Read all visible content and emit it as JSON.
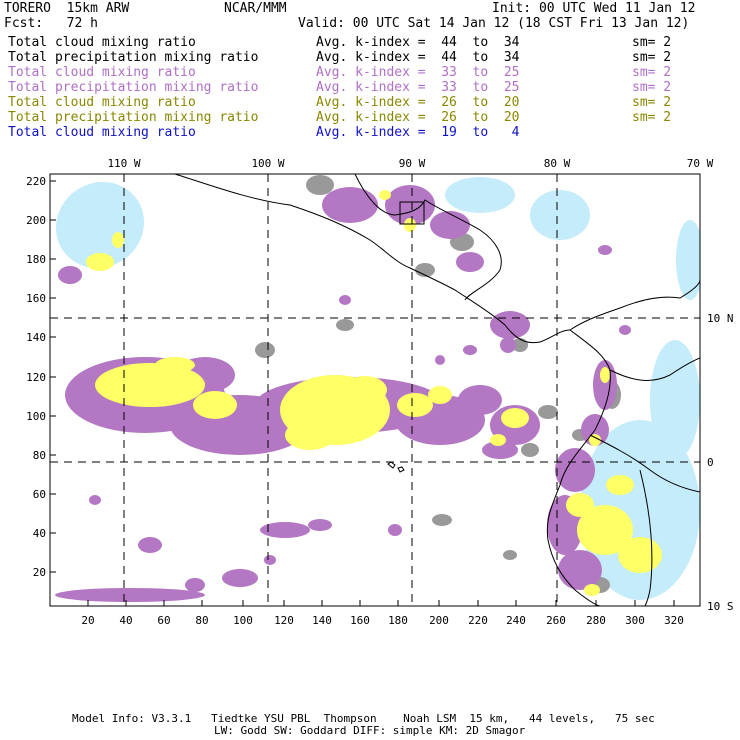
{
  "header": {
    "model": "TORERO  15km ARW",
    "org": "NCAR/MMM",
    "init": "Init: 00 UTC Wed 11 Jan 12",
    "fcst": "Fcst:   72 h",
    "valid": "Valid: 00 UTC Sat 14 Jan 12 (18 CST Fri 13 Jan 12)"
  },
  "legend": [
    {
      "field": "Total cloud mixing ratio",
      "kindex": "Avg. k-index =  44  to  34",
      "sm": "sm= 2",
      "color": "#000000"
    },
    {
      "field": "Total precipitation mixing ratio",
      "kindex": "Avg. k-index =  44  to  34",
      "sm": "sm= 2",
      "color": "#000000"
    },
    {
      "field": "Total cloud mixing ratio",
      "kindex": "Avg. k-index =  33  to  25",
      "sm": "sm= 2",
      "color": "#b070c8"
    },
    {
      "field": "Total precipitation mixing ratio",
      "kindex": "Avg. k-index =  33  to  25",
      "sm": "sm= 2",
      "color": "#b070c8"
    },
    {
      "field": "Total cloud mixing ratio",
      "kindex": "Avg. k-index =  26  to  20",
      "sm": "sm= 2",
      "color": "#888800"
    },
    {
      "field": "Total precipitation mixing ratio",
      "kindex": "Avg. k-index =  26  to  20",
      "sm": "sm= 2",
      "color": "#888800"
    },
    {
      "field": "Total cloud mixing ratio",
      "kindex": "Avg. k-index =  19  to   4",
      "sm": "",
      "color": "#1010c8"
    }
  ],
  "map": {
    "lon_labels": [
      "110 W",
      "100 W",
      "90 W",
      "80 W",
      "70 W"
    ],
    "lat_labels": [
      "10 N",
      "0",
      "10 S"
    ],
    "y_ticks": [
      "220",
      "200",
      "180",
      "160",
      "140",
      "120",
      "100",
      "80",
      "60",
      "40",
      "20"
    ],
    "x_ticks": [
      "20",
      "40",
      "60",
      "80",
      "100",
      "120",
      "140",
      "160",
      "180",
      "200",
      "220",
      "240",
      "260",
      "280",
      "300",
      "320"
    ],
    "colors": {
      "gray": "#999999",
      "purple": "#b377c4",
      "yellow": "#ffff66",
      "cyan": "#c4ecfa"
    }
  },
  "footer": {
    "line1": "Model Info: V3.3.1   Tiedtke YSU PBL  Thompson    Noah LSM  15 km,   44 levels,   75 sec",
    "line2": "LW: Godd SW: Goddard DIFF: simple KM: 2D Smagor"
  }
}
